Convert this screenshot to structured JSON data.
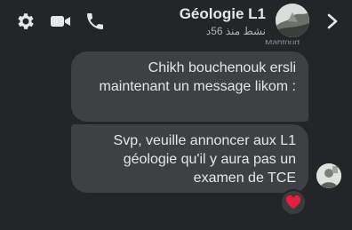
{
  "header": {
    "title": "Géologie L1",
    "status": "نشط منذ 56د",
    "icons": [
      "gear-icon",
      "video-camera-icon",
      "phone-icon",
      "chevron-right-icon"
    ]
  },
  "conversation": {
    "cut_label": "Mahfoud",
    "messages": [
      {
        "text": "Chikh bouchenouk ersli maintenant un message likom :"
      },
      {
        "text": "Svp, veuille annoncer aux L1 géologie qu'il y aura pas un examen de TCE"
      }
    ],
    "reaction": "heart"
  },
  "colors": {
    "background": "#242526",
    "bubble": "#3e4042",
    "text": "#e4e6eb",
    "heart": "#e41e3f"
  }
}
